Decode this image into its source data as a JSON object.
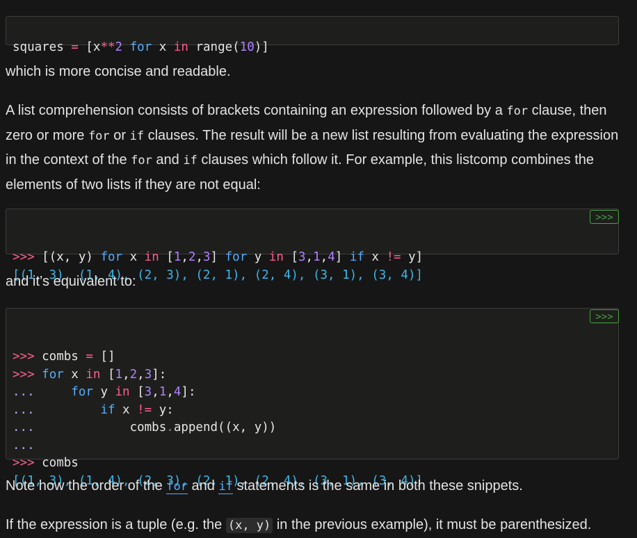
{
  "block1": {
    "code": "squares = [x**2 for x in range(10)]"
  },
  "para1": "which is more concise and readable.",
  "para2": {
    "t1": "A list comprehension consists of brackets containing an expression followed by a ",
    "c1": "for",
    "t2": " clause, then zero or more ",
    "c2": "for",
    "t3": " or ",
    "c3": "if",
    "t4": " clauses. The result will be a new list resulting from evaluating the expression in the context of the ",
    "c4": "for",
    "t5": " and ",
    "c5": "if",
    "t6": " clauses which follow it. For example, this listcomp combines the elements of two lists if they are not equal:"
  },
  "block2": {
    "copy_label": ">>>",
    "prompt": ">>>",
    "output": "[(1, 3), (1, 4), (2, 3), (2, 1), (2, 4), (3, 1), (3, 4)]"
  },
  "para3": "and it’s equivalent to:",
  "block3": {
    "copy_label": ">>>",
    "prompt": ">>>",
    "cont": "...",
    "output": "[(1, 3), (1, 4), (2, 3), (2, 1), (2, 4), (3, 1), (3, 4)]"
  },
  "para4": {
    "t1": "Note how the order of the ",
    "c1": "for",
    "t2": " and ",
    "c2": "if",
    "t3": " statements is the same in both these snippets."
  },
  "para5": {
    "t1": "If the expression is a tuple (e.g. the ",
    "c1": "(x, y)",
    "t2": " in the previous example), it must be parenthesized."
  },
  "colors": {
    "background": "#161616",
    "code_bg": "#1e1f1c",
    "keyword": "#54aeff",
    "operator": "#ff5d8f",
    "number": "#ae81ff",
    "output": "#3fb7e8",
    "copy_button": "#46a33e"
  }
}
